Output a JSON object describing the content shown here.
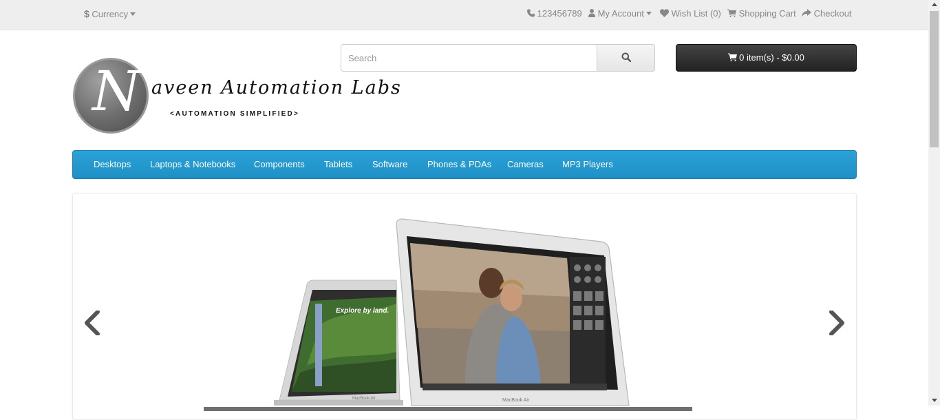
{
  "topbar": {
    "currency_symbol": "$",
    "currency_label": "Currency",
    "phone": "123456789",
    "my_account": "My Account",
    "wish_list": "Wish List (0)",
    "shopping_cart": "Shopping Cart",
    "checkout": "Checkout"
  },
  "logo": {
    "letter": "N",
    "brand": "aveen Automation Labs",
    "tagline": "<AUTOMATION SIMPLIFIED>"
  },
  "search": {
    "placeholder": "Search"
  },
  "cart": {
    "label": "0 item(s) - $0.00"
  },
  "menu": {
    "items": [
      "Desktops",
      "Laptops & Notebooks",
      "Components",
      "Tablets",
      "Software",
      "Phones & PDAs",
      "Cameras",
      "MP3 Players"
    ]
  },
  "slideshow": {
    "back_screen_heading": "Explore by land.",
    "laptop_brand": "MacBook Air"
  },
  "colors": {
    "menu_blue": "#229ac8",
    "cart_dark": "#363636",
    "topbar_bg": "#eeeeee"
  }
}
